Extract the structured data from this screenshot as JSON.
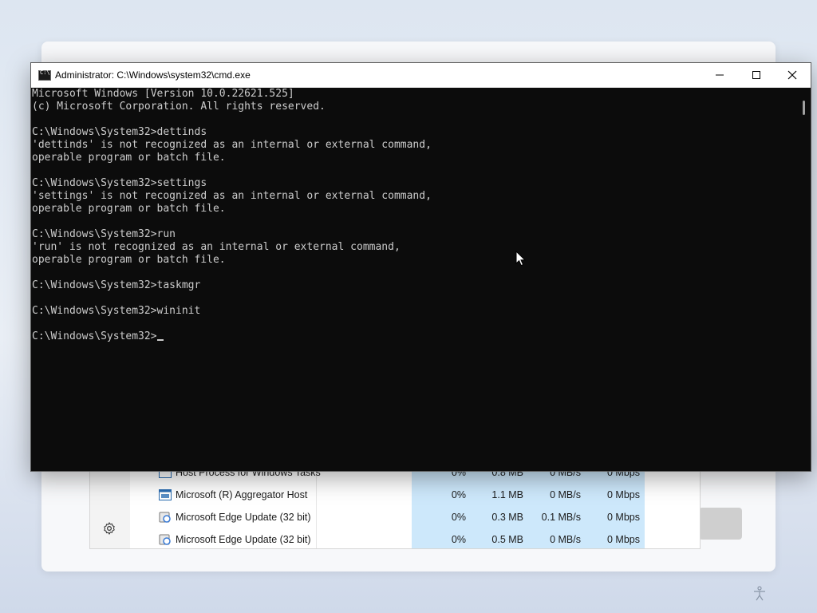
{
  "cmd": {
    "title": "Administrator: C:\\Windows\\system32\\cmd.exe",
    "icon_glyph": "C:\\",
    "console_lines": [
      "Microsoft Windows [Version 10.0.22621.525]",
      "(c) Microsoft Corporation. All rights reserved.",
      "",
      "C:\\Windows\\System32>dettinds",
      "'dettinds' is not recognized as an internal or external command,",
      "operable program or batch file.",
      "",
      "C:\\Windows\\System32>settings",
      "'settings' is not recognized as an internal or external command,",
      "operable program or batch file.",
      "",
      "C:\\Windows\\System32>run",
      "'run' is not recognized as an internal or external command,",
      "operable program or batch file.",
      "",
      "C:\\Windows\\System32>taskmgr",
      "",
      "C:\\Windows\\System32>wininit",
      ""
    ],
    "prompt": "C:\\Windows\\System32>",
    "colors": {
      "background": "#0c0c0c",
      "text": "#cccccc"
    }
  },
  "task_manager": {
    "processes": [
      {
        "name": "Host Process for Windows Tasks",
        "cpu": "0%",
        "memory": "0.8 MB",
        "disk": "0 MB/s",
        "network": "0 Mbps",
        "icon": "app-window-icon"
      },
      {
        "name": "Microsoft (R) Aggregator Host",
        "cpu": "0%",
        "memory": "1.1 MB",
        "disk": "0 MB/s",
        "network": "0 Mbps",
        "icon": "app-window-icon"
      },
      {
        "name": "Microsoft Edge Update (32 bit)",
        "cpu": "0%",
        "memory": "0.3 MB",
        "disk": "0.1 MB/s",
        "network": "0 Mbps",
        "icon": "edge-update-icon"
      },
      {
        "name": "Microsoft Edge Update (32 bit)",
        "cpu": "0%",
        "memory": "0.5 MB",
        "disk": "0 MB/s",
        "network": "0 Mbps",
        "icon": "edge-update-icon"
      }
    ],
    "heat_color": "#cde8fb"
  }
}
